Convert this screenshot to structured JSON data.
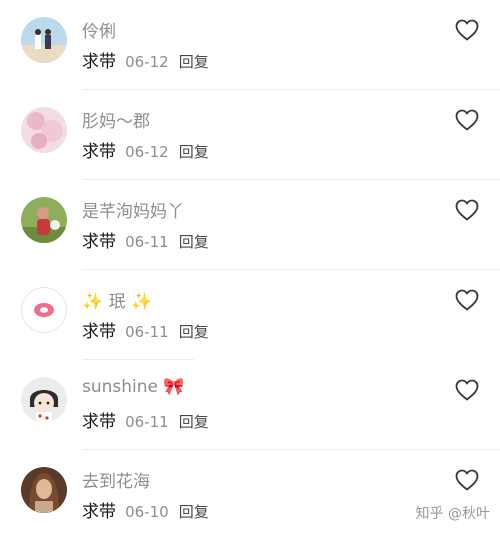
{
  "comments": [
    {
      "name": "伶俐",
      "text": "求带",
      "date": "06-12",
      "reply": "回复"
    },
    {
      "name": "肜妈～郡",
      "text": "求带",
      "date": "06-12",
      "reply": "回复"
    },
    {
      "name": "是芊洵妈妈丫",
      "text": "求带",
      "date": "06-11",
      "reply": "回复"
    },
    {
      "name_prefix": "✨",
      "name": "珉",
      "name_suffix": "✨",
      "text": "求带",
      "date": "06-11",
      "reply": "回复"
    },
    {
      "name": "sunshine",
      "name_suffix": "🎀",
      "text": "求带",
      "date": "06-11",
      "reply": "回复"
    },
    {
      "name": "去到花海",
      "text": "求带",
      "date": "06-10",
      "reply": "回复"
    }
  ],
  "watermark": "知乎 @秋叶",
  "icons": {
    "like": "heart-outline-icon"
  },
  "colors": {
    "name": "#8e8e8e",
    "text": "#1a1a1a",
    "divider": "#ececec"
  }
}
